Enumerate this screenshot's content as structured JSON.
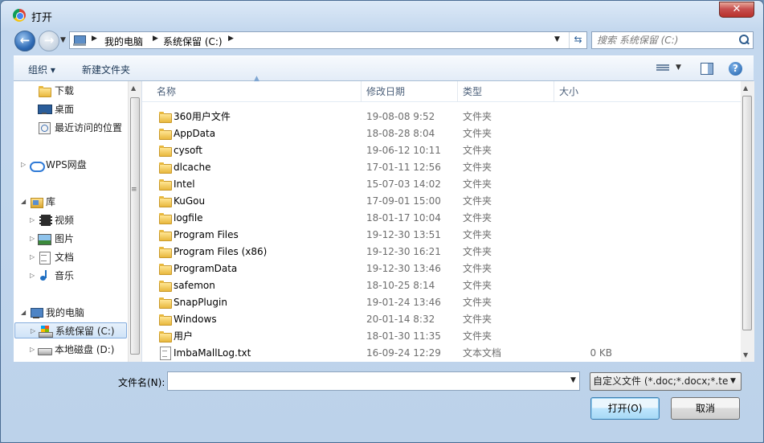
{
  "window": {
    "title": "打开",
    "close_glyph": "✕"
  },
  "address": {
    "crumbs": [
      "我的电脑",
      "系统保留 (C:)"
    ],
    "search_placeholder": "搜索 系统保留 (C:)"
  },
  "toolbar": {
    "organize": "组织 ▾",
    "new_folder": "新建文件夹",
    "help": "?"
  },
  "sidebar": {
    "items": [
      {
        "label": "下载",
        "icon": "download-folder-icon"
      },
      {
        "label": "桌面",
        "icon": "desktop-icon"
      },
      {
        "label": "最近访问的位置",
        "icon": "recent-places-icon"
      },
      {
        "label": "WPS网盘",
        "icon": "cloud-icon"
      },
      {
        "label": "库",
        "icon": "library-icon"
      },
      {
        "label": "视频",
        "icon": "video-icon"
      },
      {
        "label": "图片",
        "icon": "picture-icon"
      },
      {
        "label": "文档",
        "icon": "document-icon"
      },
      {
        "label": "音乐",
        "icon": "music-icon"
      },
      {
        "label": "我的电脑",
        "icon": "computer-icon"
      },
      {
        "label": "系统保留 (C:)",
        "icon": "system-drive-icon"
      },
      {
        "label": "本地磁盘 (D:)",
        "icon": "drive-icon"
      }
    ]
  },
  "columns": {
    "name": "名称",
    "date": "修改日期",
    "type": "类型",
    "size": "大小"
  },
  "files": [
    {
      "name": "360用户文件",
      "date": "19-08-08 9:52",
      "type": "文件夹",
      "size": ""
    },
    {
      "name": "AppData",
      "date": "18-08-28 8:04",
      "type": "文件夹",
      "size": ""
    },
    {
      "name": "cysoft",
      "date": "19-06-12 10:11",
      "type": "文件夹",
      "size": ""
    },
    {
      "name": "dlcache",
      "date": "17-01-11 12:56",
      "type": "文件夹",
      "size": ""
    },
    {
      "name": "Intel",
      "date": "15-07-03 14:02",
      "type": "文件夹",
      "size": ""
    },
    {
      "name": "KuGou",
      "date": "17-09-01 15:00",
      "type": "文件夹",
      "size": ""
    },
    {
      "name": "logfile",
      "date": "18-01-17 10:04",
      "type": "文件夹",
      "size": ""
    },
    {
      "name": "Program Files",
      "date": "19-12-30 13:51",
      "type": "文件夹",
      "size": ""
    },
    {
      "name": "Program Files (x86)",
      "date": "19-12-30 16:21",
      "type": "文件夹",
      "size": ""
    },
    {
      "name": "ProgramData",
      "date": "19-12-30 13:46",
      "type": "文件夹",
      "size": ""
    },
    {
      "name": "safemon",
      "date": "18-10-25 8:14",
      "type": "文件夹",
      "size": ""
    },
    {
      "name": "SnapPlugin",
      "date": "19-01-24 13:46",
      "type": "文件夹",
      "size": ""
    },
    {
      "name": "Windows",
      "date": "20-01-14 8:32",
      "type": "文件夹",
      "size": ""
    },
    {
      "name": "用户",
      "date": "18-01-30 11:35",
      "type": "文件夹",
      "size": ""
    },
    {
      "name": "ImbaMallLog.txt",
      "date": "16-09-24 12:29",
      "type": "文本文档",
      "size": "0 KB"
    }
  ],
  "bottom": {
    "filename_label": "文件名(N):",
    "filename_value": "",
    "filter_value": "自定义文件 (*.doc;*.docx;*.tex",
    "open_label": "打开(O)",
    "cancel_label": "取消"
  }
}
